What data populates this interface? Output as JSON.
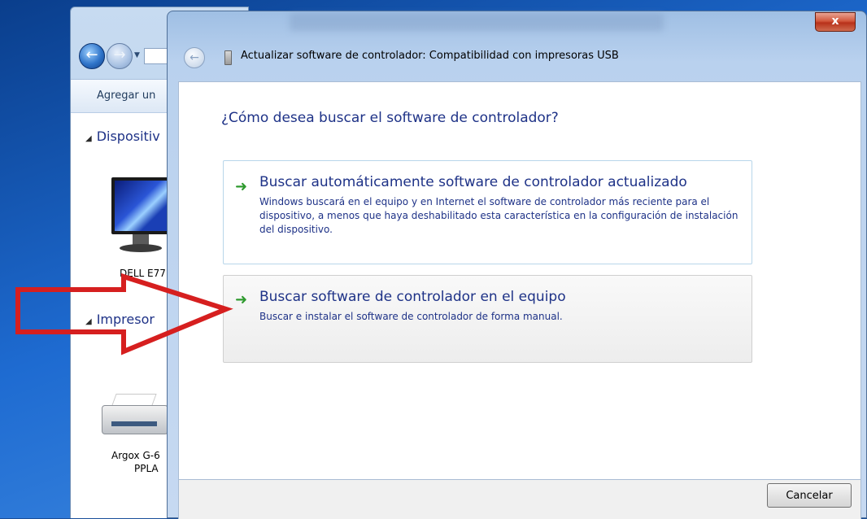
{
  "background_window": {
    "toolbar_label": "Agregar un",
    "groups": [
      {
        "label": "Dispositiv"
      },
      {
        "label": "Impresor"
      }
    ],
    "devices": [
      {
        "label": "DELL E77"
      },
      {
        "label_line1": "Argox G-6",
        "label_line2": "PPLA"
      }
    ]
  },
  "dialog": {
    "title": "Actualizar software de controlador: Compatibilidad con impresoras USB",
    "question": "¿Cómo desea buscar el software de controlador?",
    "options": [
      {
        "title": "Buscar automáticamente software de controlador actualizado",
        "description": "Windows buscará en el equipo y en Internet el software de controlador más reciente para el dispositivo, a menos que haya deshabilitado esta característica en la configuración de instalación del dispositivo."
      },
      {
        "title": "Buscar software de controlador en el equipo",
        "description": "Buscar e instalar el software de controlador de forma manual."
      }
    ],
    "cancel_label": "Cancelar",
    "close_glyph": "x"
  },
  "colors": {
    "link_blue": "#1e3287",
    "option_arrow_green": "#2f9a2f",
    "annotation_red": "#d61f1f"
  },
  "icons": [
    "back-arrow-icon",
    "forward-arrow-icon",
    "usb-device-icon",
    "green-arrow-icon",
    "monitor-icon",
    "printer-icon",
    "close-icon"
  ]
}
